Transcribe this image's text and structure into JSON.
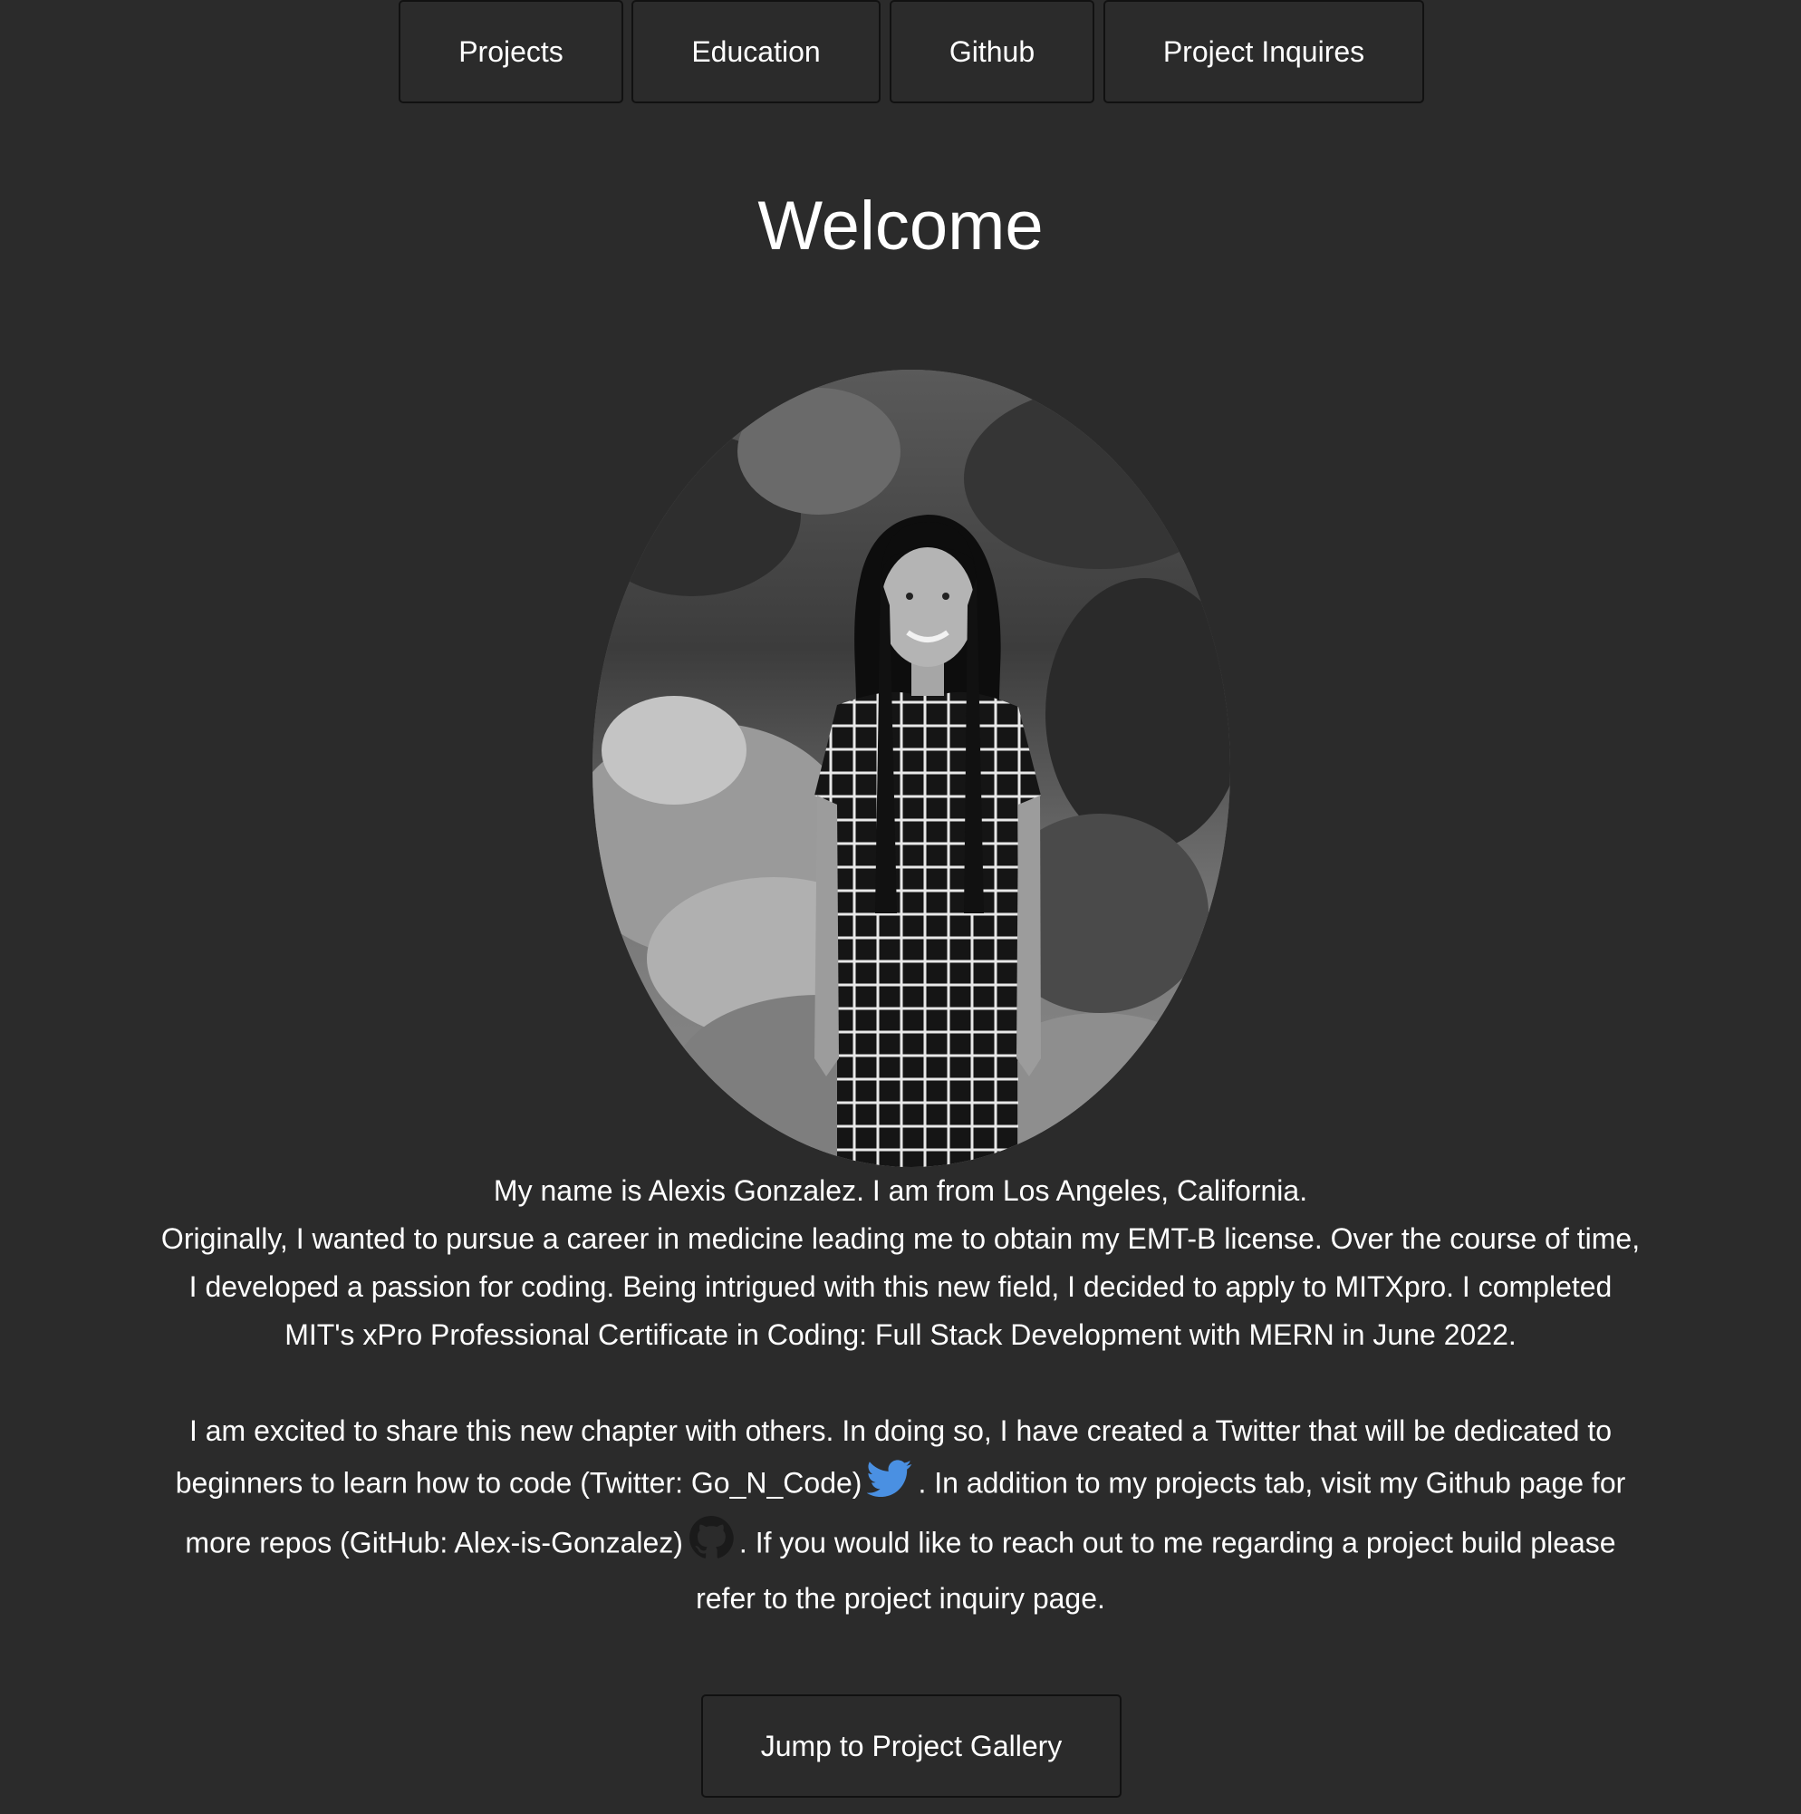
{
  "nav": {
    "items": [
      {
        "label": "Projects"
      },
      {
        "label": "Education"
      },
      {
        "label": "Github"
      },
      {
        "label": "Project Inquires"
      }
    ]
  },
  "main": {
    "title": "Welcome",
    "intro": "My name is Alexis Gonzalez. I am from Los Angeles, California.",
    "paragraph1": "Originally, I wanted to pursue a career in medicine leading me to obtain my EMT-B license. Over the course of time, I developed a passion for coding. Being intrigued with this new field, I decided to apply to MITXpro. I completed MIT's xPro Professional Certificate in Coding: Full Stack Development with MERN in June 2022.",
    "paragraph2_part1": "I am excited to share this new chapter with others. In doing so, I have created a Twitter that will be dedicated to beginners to learn how to code (Twitter: Go_N_Code)",
    "paragraph2_part2": ". In addition to my projects tab, visit my Github page for more repos (GitHub: Alex-is-Gonzalez)",
    "paragraph2_part3": ". If you would like to reach out to me regarding a project build please refer to the project inquiry page.",
    "jump_button": "Jump to Project Gallery"
  },
  "icons": {
    "twitter": "twitter-bird-icon",
    "github": "github-octocat-icon"
  },
  "colors": {
    "background": "#2b2b2b",
    "text": "#ffffff",
    "button_border": "#111111",
    "twitter_blue": "#4a90e2",
    "github_icon": "#1a1a1a"
  }
}
